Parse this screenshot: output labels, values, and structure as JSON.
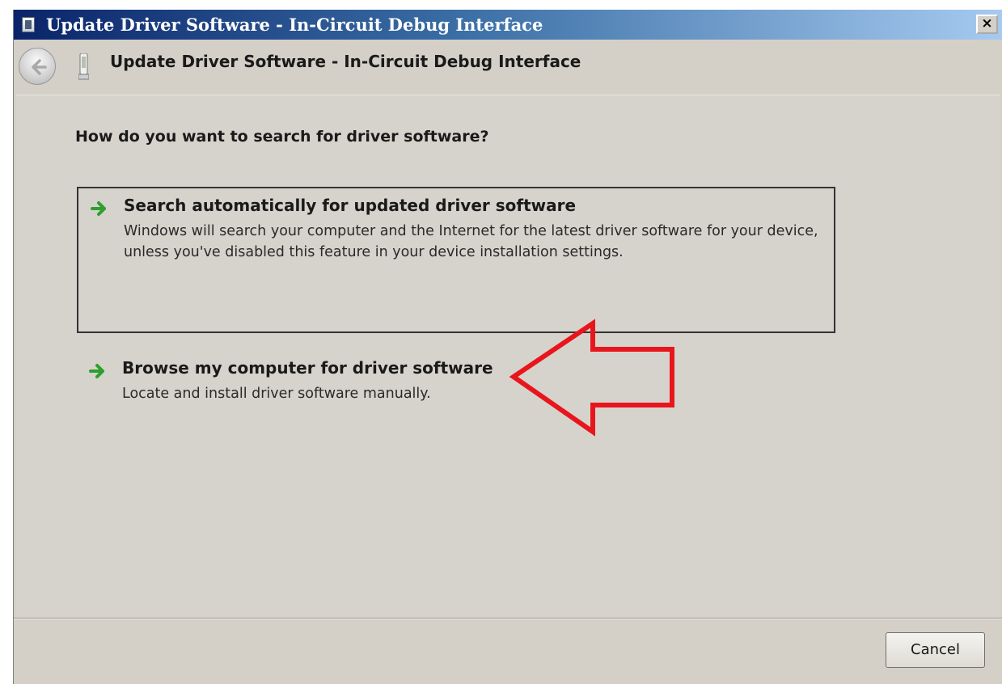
{
  "window": {
    "title": "Update Driver Software - In-Circuit Debug Interface",
    "close_label": "×"
  },
  "header": {
    "title": "Update Driver Software - In-Circuit Debug Interface",
    "back_icon": "back-arrow-icon",
    "device_icon": "usb-device-icon"
  },
  "main": {
    "question": "How do you want to search for driver software?",
    "options": [
      {
        "title": "Search automatically for updated driver software",
        "description": "Windows will search your computer and the Internet for the latest driver software for your device, unless you've disabled this feature in your device installation settings.",
        "icon": "green-arrow-icon"
      },
      {
        "title": "Browse my computer for driver software",
        "description": "Locate and install driver software manually.",
        "icon": "green-arrow-icon"
      }
    ],
    "annotation": {
      "icon": "red-arrow-annotation",
      "color": "#e8161c"
    }
  },
  "footer": {
    "cancel_label": "Cancel"
  },
  "colors": {
    "title_bar_start": "#0a246a",
    "title_bar_end": "#a6caf0",
    "window_bg": "#d4d0c8",
    "arrow_green": "#2e9e2e"
  }
}
